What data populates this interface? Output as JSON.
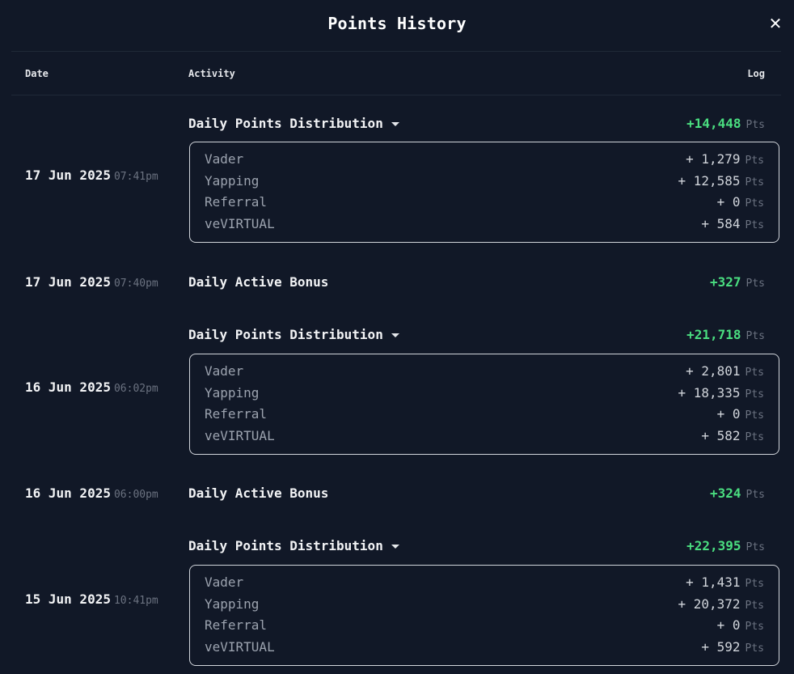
{
  "title": "Points History",
  "columns": {
    "date": "Date",
    "activity": "Activity",
    "log": "Log"
  },
  "pts_unit": "Pts",
  "entries": [
    {
      "date": "17 Jun 2025",
      "time": "07:41pm",
      "activity": "Daily Points Distribution",
      "total": "+14,448",
      "breakdown": [
        {
          "label": "Vader",
          "value": "+ 1,279"
        },
        {
          "label": "Yapping",
          "value": "+ 12,585"
        },
        {
          "label": "Referral",
          "value": "+ 0"
        },
        {
          "label": "veVIRTUAL",
          "value": "+ 584"
        }
      ]
    },
    {
      "date": "17 Jun 2025",
      "time": "07:40pm",
      "activity": "Daily Active Bonus",
      "total": "+327"
    },
    {
      "date": "16 Jun 2025",
      "time": "06:02pm",
      "activity": "Daily Points Distribution",
      "total": "+21,718",
      "breakdown": [
        {
          "label": "Vader",
          "value": "+ 2,801"
        },
        {
          "label": "Yapping",
          "value": "+ 18,335"
        },
        {
          "label": "Referral",
          "value": "+ 0"
        },
        {
          "label": "veVIRTUAL",
          "value": "+ 582"
        }
      ]
    },
    {
      "date": "16 Jun 2025",
      "time": "06:00pm",
      "activity": "Daily Active Bonus",
      "total": "+324"
    },
    {
      "date": "15 Jun 2025",
      "time": "10:41pm",
      "activity": "Daily Points Distribution",
      "total": "+22,395",
      "breakdown": [
        {
          "label": "Vader",
          "value": "+ 1,431"
        },
        {
          "label": "Yapping",
          "value": "+ 20,372"
        },
        {
          "label": "Referral",
          "value": "+ 0"
        },
        {
          "label": "veVIRTUAL",
          "value": "+ 592"
        }
      ]
    }
  ],
  "colors": {
    "background": "#111827",
    "positive": "#4ade80",
    "muted": "#6b7280",
    "border": "#d1d5db"
  }
}
